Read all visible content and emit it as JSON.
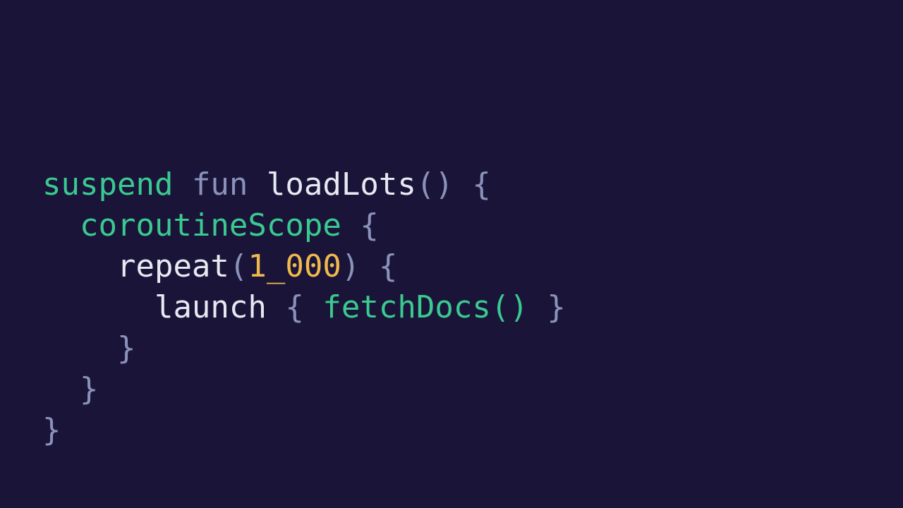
{
  "code": {
    "line1": {
      "kw_suspend": "suspend",
      "kw_fun": "fun",
      "fn_name": "loadLots",
      "parens": "()",
      "brace_open": "{"
    },
    "line2": {
      "scope_call": "coroutineScope",
      "brace_open": "{"
    },
    "line3": {
      "repeat_call": "repeat",
      "lparen": "(",
      "num": "1_000",
      "rparen": ")",
      "brace_open": "{"
    },
    "line4": {
      "launch": "launch",
      "brace_open": "{",
      "fetch_call": "fetchDocs",
      "parens": "()",
      "brace_close": "}"
    },
    "line5": {
      "brace_close": "}"
    },
    "line6": {
      "brace_close": "}"
    },
    "line7": {
      "brace_close": "}"
    }
  }
}
